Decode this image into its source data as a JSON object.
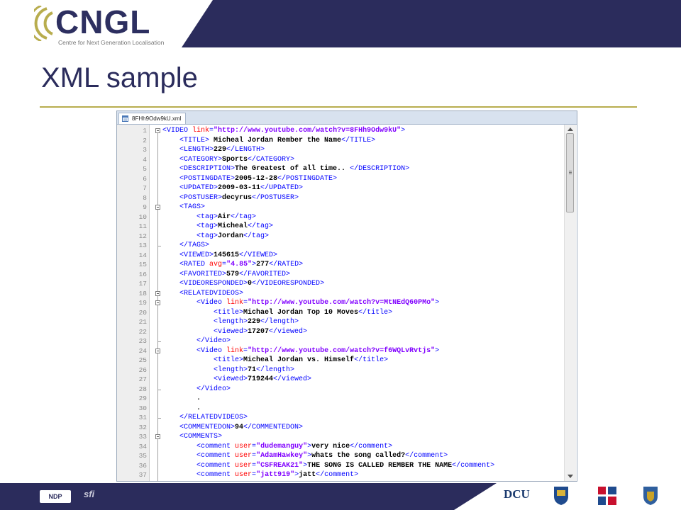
{
  "logo": {
    "name": "CNGL",
    "tagline": "Centre for Next Generation Localisation",
    "arc_color": "#b8ad4e",
    "text_color": "#2d2f60"
  },
  "slide": {
    "title": "XML sample",
    "accent_color": "#b8ad4e",
    "band_color": "#2b2c5c"
  },
  "editor": {
    "tab_label": "8FHh9Odw9kU.xml",
    "tab_icon": "xml-file-icon",
    "lines": [
      {
        "n": "1",
        "indent": 0,
        "fold": "open",
        "segs": [
          [
            "tag",
            "<VIDEO "
          ],
          [
            "attr",
            "link"
          ],
          [
            "tag",
            "="
          ],
          [
            "val",
            "\"http://www.youtube.com/watch?v=8FHh9Odw9kU\""
          ],
          [
            "tag",
            ">"
          ]
        ]
      },
      {
        "n": "2",
        "indent": 1,
        "segs": [
          [
            "tag",
            "<TITLE>"
          ],
          [
            "txt",
            " Micheal Jordan Rember the Name"
          ],
          [
            "tag",
            "</TITLE>"
          ]
        ]
      },
      {
        "n": "3",
        "indent": 1,
        "segs": [
          [
            "tag",
            "<LENGTH>"
          ],
          [
            "txt",
            "229"
          ],
          [
            "tag",
            "</LENGTH>"
          ]
        ]
      },
      {
        "n": "4",
        "indent": 1,
        "segs": [
          [
            "tag",
            "<CATEGORY>"
          ],
          [
            "txt",
            "Sports"
          ],
          [
            "tag",
            "</CATEGORY>"
          ]
        ]
      },
      {
        "n": "5",
        "indent": 1,
        "segs": [
          [
            "tag",
            "<DESCRIPTION>"
          ],
          [
            "txt",
            "The Greatest of all time.. "
          ],
          [
            "tag",
            "</DESCRIPTION>"
          ]
        ]
      },
      {
        "n": "6",
        "indent": 1,
        "segs": [
          [
            "tag",
            "<POSTINGDATE>"
          ],
          [
            "txt",
            "2005-12-28"
          ],
          [
            "tag",
            "</POSTINGDATE>"
          ]
        ]
      },
      {
        "n": "7",
        "indent": 1,
        "segs": [
          [
            "tag",
            "<UPDATED>"
          ],
          [
            "txt",
            "2009-03-11"
          ],
          [
            "tag",
            "</UPDATED>"
          ]
        ]
      },
      {
        "n": "8",
        "indent": 1,
        "segs": [
          [
            "tag",
            "<POSTUSER>"
          ],
          [
            "txt",
            "decyrus"
          ],
          [
            "tag",
            "</POSTUSER>"
          ]
        ]
      },
      {
        "n": "9",
        "indent": 1,
        "fold": "open",
        "segs": [
          [
            "tag",
            "<TAGS>"
          ]
        ]
      },
      {
        "n": "10",
        "indent": 2,
        "segs": [
          [
            "tag",
            "<tag>"
          ],
          [
            "txt",
            "Air"
          ],
          [
            "tag",
            "</tag>"
          ]
        ]
      },
      {
        "n": "11",
        "indent": 2,
        "segs": [
          [
            "tag",
            "<tag>"
          ],
          [
            "txt",
            "Micheal"
          ],
          [
            "tag",
            "</tag>"
          ]
        ]
      },
      {
        "n": "12",
        "indent": 2,
        "segs": [
          [
            "tag",
            "<tag>"
          ],
          [
            "txt",
            "Jordan"
          ],
          [
            "tag",
            "</tag>"
          ]
        ]
      },
      {
        "n": "13",
        "indent": 1,
        "fold": "end",
        "segs": [
          [
            "tag",
            "</TAGS>"
          ]
        ]
      },
      {
        "n": "14",
        "indent": 1,
        "segs": [
          [
            "tag",
            "<VIEWED>"
          ],
          [
            "txt",
            "145615"
          ],
          [
            "tag",
            "</VIEWED>"
          ]
        ]
      },
      {
        "n": "15",
        "indent": 1,
        "segs": [
          [
            "tag",
            "<RATED "
          ],
          [
            "attr",
            "avg"
          ],
          [
            "tag",
            "="
          ],
          [
            "val",
            "\"4.85\""
          ],
          [
            "tag",
            ">"
          ],
          [
            "txt",
            "277"
          ],
          [
            "tag",
            "</RATED>"
          ]
        ]
      },
      {
        "n": "16",
        "indent": 1,
        "segs": [
          [
            "tag",
            "<FAVORITED>"
          ],
          [
            "txt",
            "579"
          ],
          [
            "tag",
            "</FAVORITED>"
          ]
        ]
      },
      {
        "n": "17",
        "indent": 1,
        "segs": [
          [
            "tag",
            "<VIDEORESPONDED>"
          ],
          [
            "txt",
            "0"
          ],
          [
            "tag",
            "</VIDEORESPONDED>"
          ]
        ]
      },
      {
        "n": "18",
        "indent": 1,
        "fold": "open",
        "segs": [
          [
            "tag",
            "<RELATEDVIDEOS>"
          ]
        ]
      },
      {
        "n": "19",
        "indent": 2,
        "fold": "open",
        "segs": [
          [
            "tag",
            "<Video "
          ],
          [
            "attr",
            "link"
          ],
          [
            "tag",
            "="
          ],
          [
            "val",
            "\"http://www.youtube.com/watch?v=MtNEdQ60PMo\""
          ],
          [
            "tag",
            ">"
          ]
        ]
      },
      {
        "n": "20",
        "indent": 3,
        "segs": [
          [
            "tag",
            "<title>"
          ],
          [
            "txt",
            "Michael Jordan Top 10 Moves"
          ],
          [
            "tag",
            "</title>"
          ]
        ]
      },
      {
        "n": "21",
        "indent": 3,
        "segs": [
          [
            "tag",
            "<length>"
          ],
          [
            "txt",
            "229"
          ],
          [
            "tag",
            "</length>"
          ]
        ]
      },
      {
        "n": "22",
        "indent": 3,
        "segs": [
          [
            "tag",
            "<viewed>"
          ],
          [
            "txt",
            "17207"
          ],
          [
            "tag",
            "</viewed>"
          ]
        ]
      },
      {
        "n": "23",
        "indent": 2,
        "fold": "end",
        "segs": [
          [
            "tag",
            "</Video>"
          ]
        ]
      },
      {
        "n": "24",
        "indent": 2,
        "fold": "open",
        "segs": [
          [
            "tag",
            "<Video "
          ],
          [
            "attr",
            "link"
          ],
          [
            "tag",
            "="
          ],
          [
            "val",
            "\"http://www.youtube.com/watch?v=f6WQLvRvtjs\""
          ],
          [
            "tag",
            ">"
          ]
        ]
      },
      {
        "n": "25",
        "indent": 3,
        "segs": [
          [
            "tag",
            "<title>"
          ],
          [
            "txt",
            "Micheal Jordan vs. Himself"
          ],
          [
            "tag",
            "</title>"
          ]
        ]
      },
      {
        "n": "26",
        "indent": 3,
        "segs": [
          [
            "tag",
            "<length>"
          ],
          [
            "txt",
            "71"
          ],
          [
            "tag",
            "</length>"
          ]
        ]
      },
      {
        "n": "27",
        "indent": 3,
        "segs": [
          [
            "tag",
            "<viewed>"
          ],
          [
            "txt",
            "719244"
          ],
          [
            "tag",
            "</viewed>"
          ]
        ]
      },
      {
        "n": "28",
        "indent": 2,
        "fold": "end",
        "segs": [
          [
            "tag",
            "</Video>"
          ]
        ]
      },
      {
        "n": "29",
        "indent": 2,
        "segs": [
          [
            "txt",
            "."
          ]
        ]
      },
      {
        "n": "30",
        "indent": 2,
        "segs": [
          [
            "txt",
            "."
          ]
        ]
      },
      {
        "n": "31",
        "indent": 1,
        "fold": "end",
        "segs": [
          [
            "tag",
            "</RELATEDVIDEOS>"
          ]
        ]
      },
      {
        "n": "32",
        "indent": 1,
        "segs": [
          [
            "tag",
            "<COMMENTEDON>"
          ],
          [
            "txt",
            "94"
          ],
          [
            "tag",
            "</COMMENTEDON>"
          ]
        ]
      },
      {
        "n": "33",
        "indent": 1,
        "fold": "open",
        "segs": [
          [
            "tag",
            "<COMMENTS>"
          ]
        ]
      },
      {
        "n": "34",
        "indent": 2,
        "segs": [
          [
            "tag",
            "<comment "
          ],
          [
            "attr",
            "user"
          ],
          [
            "tag",
            "="
          ],
          [
            "val",
            "\"dudemanguy\""
          ],
          [
            "tag",
            ">"
          ],
          [
            "txt",
            "very nice"
          ],
          [
            "tag",
            "</comment>"
          ]
        ]
      },
      {
        "n": "35",
        "indent": 2,
        "segs": [
          [
            "tag",
            "<comment "
          ],
          [
            "attr",
            "user"
          ],
          [
            "tag",
            "="
          ],
          [
            "val",
            "\"AdamHawkey\""
          ],
          [
            "tag",
            ">"
          ],
          [
            "txt",
            "whats the song called?"
          ],
          [
            "tag",
            "</comment>"
          ]
        ]
      },
      {
        "n": "36",
        "indent": 2,
        "segs": [
          [
            "tag",
            "<comment "
          ],
          [
            "attr",
            "user"
          ],
          [
            "tag",
            "="
          ],
          [
            "val",
            "\"CSFREAK21\""
          ],
          [
            "tag",
            ">"
          ],
          [
            "txt",
            "THE SONG IS CALLED REMBER THE NAME"
          ],
          [
            "tag",
            "</comment>"
          ]
        ]
      },
      {
        "n": "37",
        "indent": 2,
        "segs": [
          [
            "tag",
            "<comment "
          ],
          [
            "attr",
            "user"
          ],
          [
            "tag",
            "="
          ],
          [
            "val",
            "\"jatt919\""
          ],
          [
            "tag",
            ">"
          ],
          [
            "txt",
            "jatt"
          ],
          [
            "tag",
            "</comment>"
          ]
        ]
      }
    ]
  },
  "footer": {
    "ndp_label": "NDP",
    "sfi_label": "sfi",
    "dcu_label": "DCU"
  }
}
